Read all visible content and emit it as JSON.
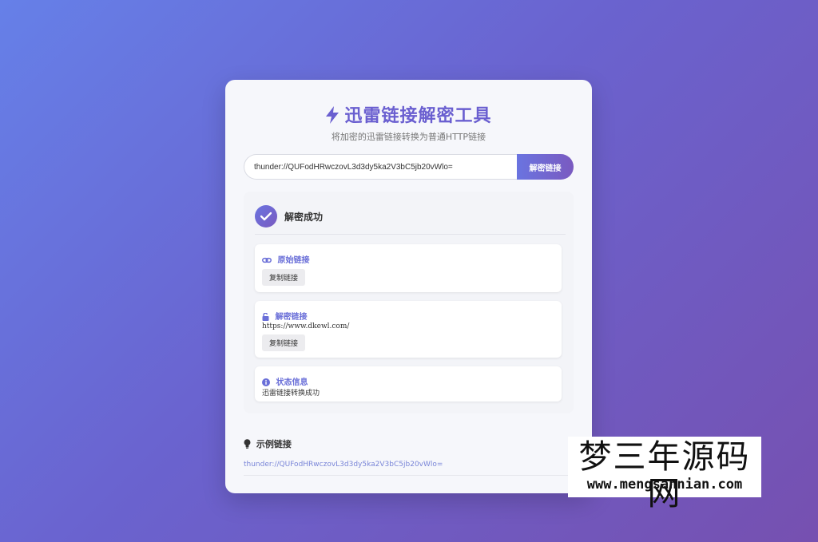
{
  "header": {
    "title": "迅雷链接解密工具",
    "subtitle": "将加密的迅雷链接转换为普通HTTP链接",
    "title_icon": "lightning-bolt-icon"
  },
  "form": {
    "input_value": "thunder://QUFodHRwczovL3d3dy5ka2V3bC5jb20vWlo=",
    "decrypt_label": "解密链接"
  },
  "result": {
    "title": "解密成功",
    "original": {
      "label": "原始链接",
      "icon": "link-icon",
      "copy_label": "复制链接"
    },
    "decrypted": {
      "label": "解密链接",
      "icon": "unlock-icon",
      "url": "https://www.dkewl.com/",
      "copy_label": "复制链接"
    },
    "status": {
      "label": "状态信息",
      "icon": "info-icon",
      "text": "迅雷链接转换成功"
    }
  },
  "example": {
    "title": "示例链接",
    "icon": "lightbulb-icon",
    "link": "thunder://QUFodHRwczovL3d3dy5ka2V3bC5jb20vWlo="
  },
  "watermark": {
    "cn": "梦三年源码网",
    "en": "www.mengsannian.com"
  },
  "colors": {
    "accent": "#6a5fd0",
    "accent_gradient_start": "#6a74e0",
    "accent_gradient_end": "#7a5ac0",
    "background_start": "#6680e8",
    "background_end": "#7650b0"
  }
}
